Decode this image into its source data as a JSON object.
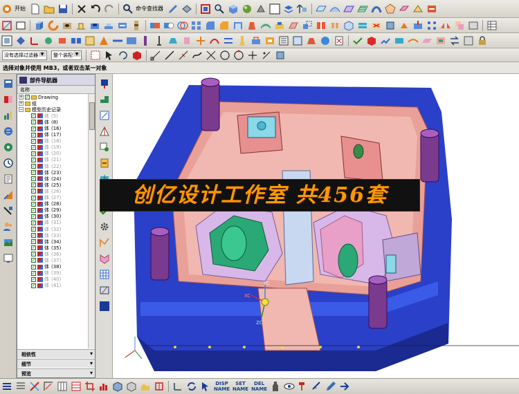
{
  "toolbar": {
    "start_label": "开始",
    "command_finder_label": "命令查找器",
    "selection_filter": "没有选择过滤器",
    "assembly_scope": "整个装配"
  },
  "status": {
    "prompt": "选择对象并使用 MB3，或者双击某一对象"
  },
  "navigator": {
    "title": "部件导航器",
    "column_header": "名称",
    "root_items": [
      {
        "label": "Drawing",
        "type": "drawing"
      },
      {
        "label": "组",
        "type": "group"
      },
      {
        "label": "模型历史记录",
        "type": "history"
      }
    ],
    "body_prefix": "体",
    "bodies": [
      {
        "num": "(5)",
        "suppressed": true
      },
      {
        "num": "(8)",
        "suppressed": false
      },
      {
        "num": "(16)",
        "suppressed": false
      },
      {
        "num": "(17)",
        "suppressed": false
      },
      {
        "num": "(18)",
        "suppressed": true
      },
      {
        "num": "(19)",
        "suppressed": true
      },
      {
        "num": "(20)",
        "suppressed": true
      },
      {
        "num": "(21)",
        "suppressed": true
      },
      {
        "num": "(22)",
        "suppressed": true
      },
      {
        "num": "(23)",
        "suppressed": false
      },
      {
        "num": "(24)",
        "suppressed": false
      },
      {
        "num": "(25)",
        "suppressed": false
      },
      {
        "num": "(26)",
        "suppressed": true
      },
      {
        "num": "(27)",
        "suppressed": true
      },
      {
        "num": "(28)",
        "suppressed": false
      },
      {
        "num": "(29)",
        "suppressed": false
      },
      {
        "num": "(30)",
        "suppressed": false
      },
      {
        "num": "(31)",
        "suppressed": true
      },
      {
        "num": "(32)",
        "suppressed": true
      },
      {
        "num": "(33)",
        "suppressed": true
      },
      {
        "num": "(34)",
        "suppressed": false
      },
      {
        "num": "(35)",
        "suppressed": false
      },
      {
        "num": "(36)",
        "suppressed": true
      },
      {
        "num": "(37)",
        "suppressed": true
      },
      {
        "num": "(38)",
        "suppressed": false
      },
      {
        "num": "(39)",
        "suppressed": true
      },
      {
        "num": "(40)",
        "suppressed": true
      },
      {
        "num": "(41)",
        "suppressed": true
      }
    ],
    "panels": [
      "相依性",
      "细节",
      "预览"
    ]
  },
  "viewport": {
    "axis_labels": {
      "xc": "XC",
      "yc": "YC",
      "zc": "ZC"
    }
  },
  "banner": {
    "text": "创亿设计工作室 共456套"
  },
  "bottom_bar": {
    "disp_top": "DISP",
    "disp_bottom": "NAME",
    "set_top": "SET",
    "set_bottom": "NAME",
    "del_top": "DEL",
    "del_bottom": "NAME"
  },
  "colors": {
    "base_plate": "#2a40c8",
    "cavity_pink": "#f0a8a0",
    "cavity_green": "#2aa876",
    "pillar_purple": "#7a3a8e",
    "banner_text": "#ff9900",
    "viewport_bg": "#ffffff"
  }
}
